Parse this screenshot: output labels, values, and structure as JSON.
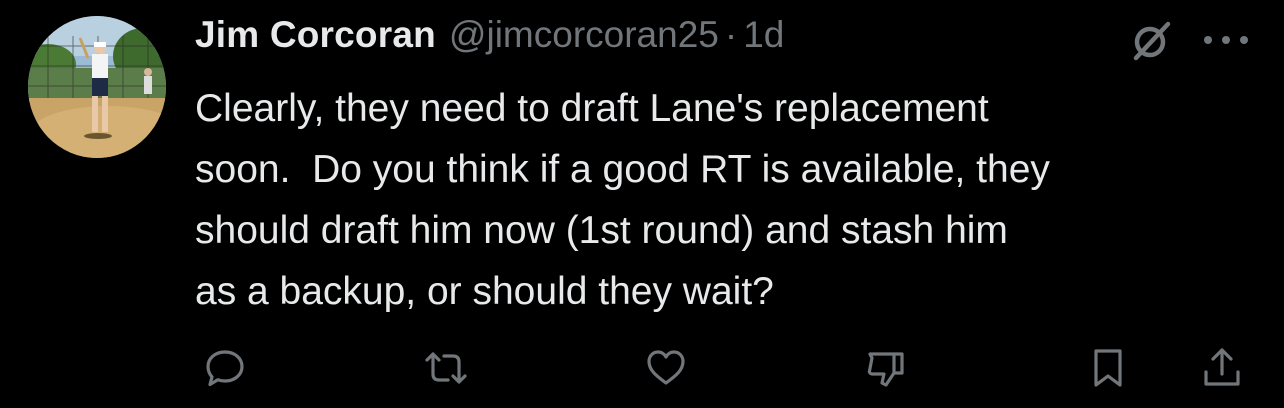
{
  "author": {
    "name": "Jim Corcoran",
    "handle": "@jimcorcoran25",
    "separator": "·",
    "time": "1d",
    "avatar_icon": "baseball-batter-photo"
  },
  "tweet": {
    "text": "Clearly, they need to draft Lane's replacement\nsoon.  Do you think if a good RT is available, they\nshould draft him now (1st round) and stash him\nas a backup, or should they wait?"
  },
  "header_icons": [
    "grok-icon",
    "more-icon"
  ],
  "actions": [
    "reply-icon",
    "retweet-icon",
    "like-icon",
    "dislike-icon",
    "bookmark-icon",
    "share-icon"
  ],
  "colors": {
    "background": "#000000",
    "text": "#e7e9ea",
    "secondary": "#71767b"
  }
}
